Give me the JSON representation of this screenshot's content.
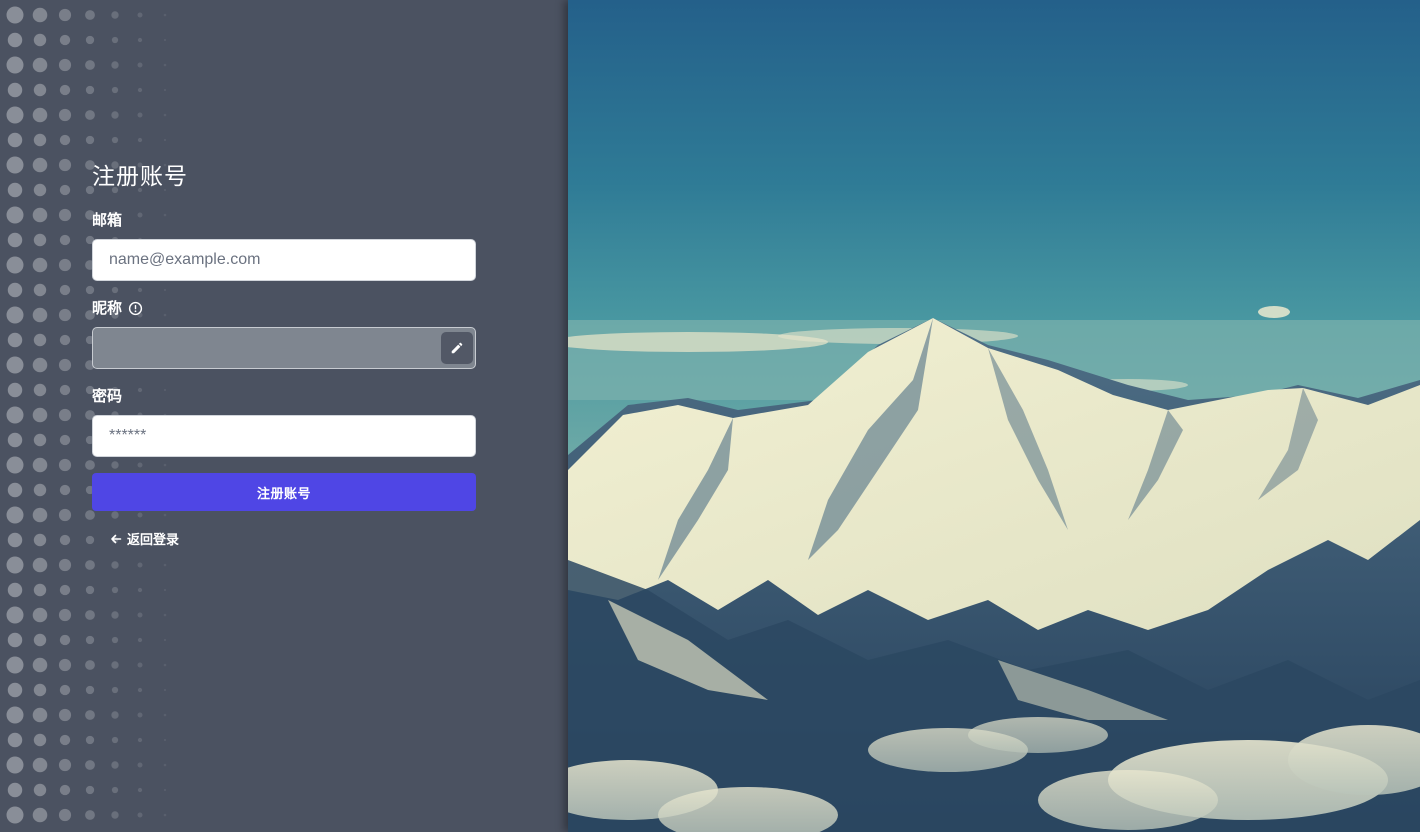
{
  "form": {
    "title": "注册账号",
    "email": {
      "label": "邮箱",
      "placeholder": "name@example.com",
      "value": ""
    },
    "nickname": {
      "label": "昵称",
      "value": "",
      "info_icon": "info-circle-icon",
      "edit_icon": "pencil-icon"
    },
    "password": {
      "label": "密码",
      "placeholder": "******",
      "value": ""
    },
    "submit_label": "注册账号",
    "back_label": "返回登录",
    "back_icon": "arrow-left-icon"
  },
  "colors": {
    "panel_bg": "#4b5261",
    "primary_button": "#4f46e5",
    "disabled_input": "#7f8690"
  },
  "background_image": {
    "subject": "snow-capped mountain range under blue sky"
  }
}
